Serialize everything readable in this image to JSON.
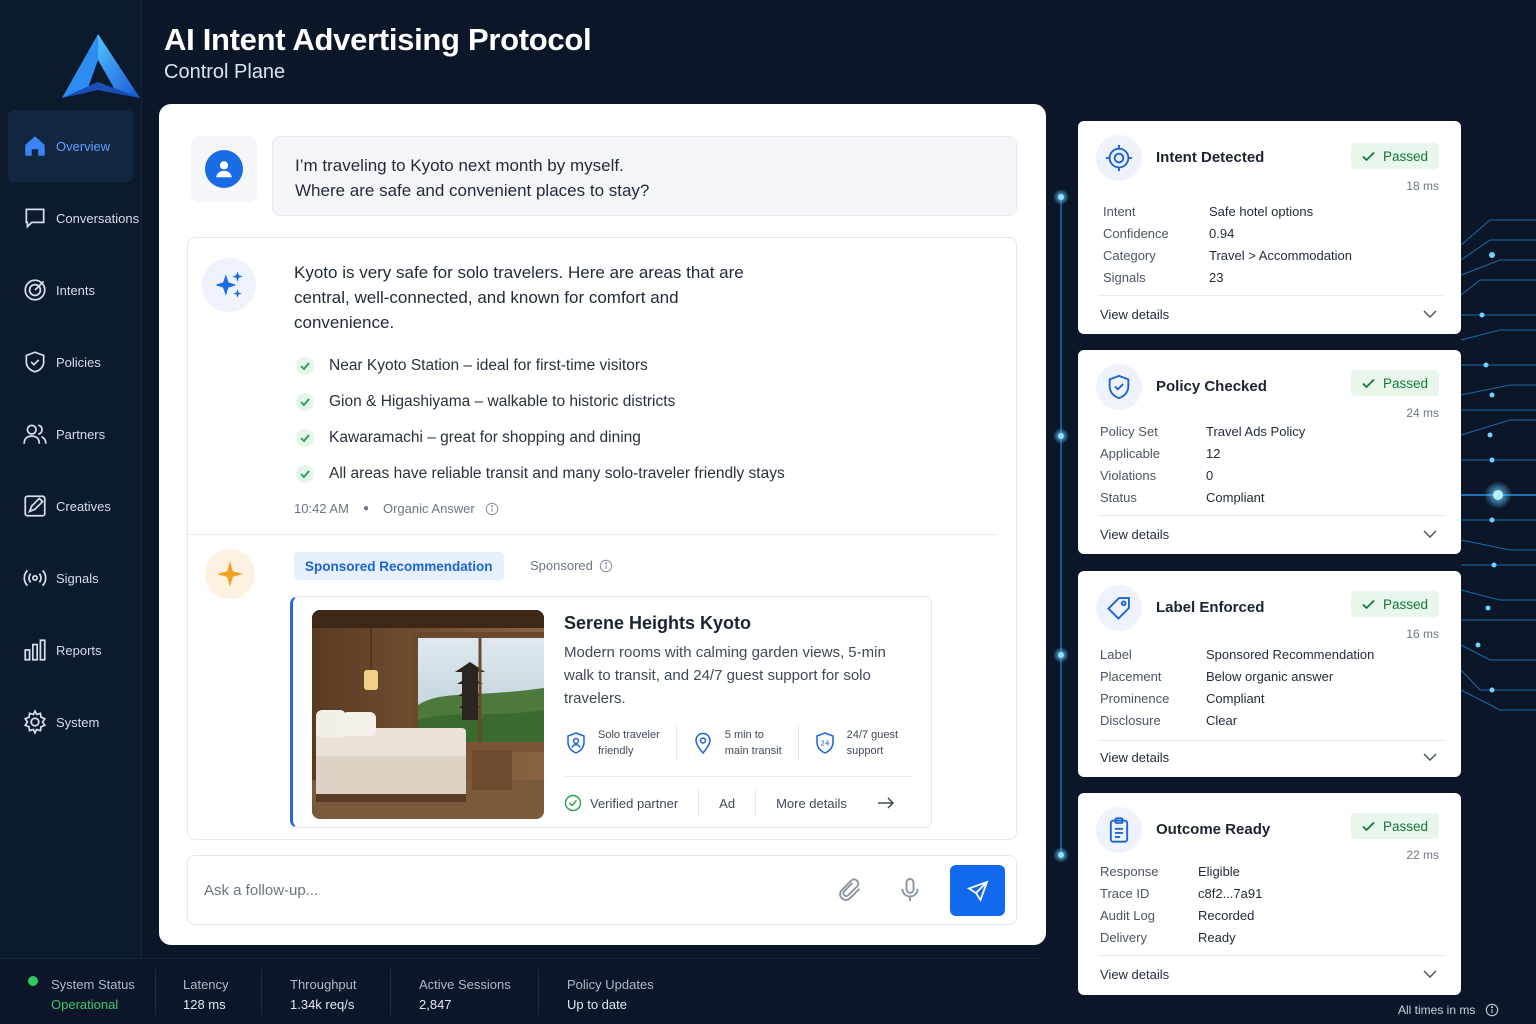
{
  "header": {
    "title": "AI Intent Advertising Protocol",
    "subtitle": "Control Plane"
  },
  "sidebar": {
    "items": [
      {
        "label": "Overview",
        "icon": "home-icon",
        "active": true
      },
      {
        "label": "Conversations",
        "icon": "chat-icon"
      },
      {
        "label": "Intents",
        "icon": "target-icon"
      },
      {
        "label": "Policies",
        "icon": "shield-icon"
      },
      {
        "label": "Partners",
        "icon": "users-icon"
      },
      {
        "label": "Creatives",
        "icon": "edit-icon"
      },
      {
        "label": "Signals",
        "icon": "signal-icon"
      },
      {
        "label": "Reports",
        "icon": "bar-chart-icon"
      },
      {
        "label": "System",
        "icon": "gear-icon"
      }
    ]
  },
  "chat": {
    "user_message_line1": "I’m traveling to Kyoto next month by myself.",
    "user_message_line2": "Where are safe and convenient places to stay?",
    "answer": "Kyoto is very safe for solo travelers. Here are areas that are central, well-connected, and known for comfort and convenience.",
    "bullets": [
      "Near Kyoto Station – ideal for first-time visitors",
      "Gion & Higashiyama – walkable to historic districts",
      "Kawaramachi – great for shopping and dining",
      "All areas have reliable transit and many solo-traveler friendly stays"
    ],
    "time": "10:42 AM",
    "answer_type": "Organic Answer",
    "sponsored_label": "Sponsored Recommendation",
    "sponsored_text": "Sponsored",
    "ad": {
      "title": "Serene Heights Kyoto",
      "description": "Modern rooms with calming garden views, 5-min walk to transit, and 24/7 guest support for solo travelers.",
      "features": [
        {
          "line1": "Solo traveler",
          "line2": "friendly",
          "icon": "person-shield-icon"
        },
        {
          "line1": "5 min to",
          "line2": "main transit",
          "icon": "location-pin-icon"
        },
        {
          "line1": "24/7 guest",
          "line2": "support",
          "icon": "24-hour-icon"
        }
      ],
      "verified": "Verified partner",
      "ad_label": "Ad",
      "more": "More details"
    },
    "input_placeholder": "Ask a follow-up..."
  },
  "cards": [
    {
      "title": "Intent Detected",
      "status": "Passed",
      "ms": "18 ms",
      "icon": "target-icon",
      "rows": [
        [
          "Intent",
          "Safe hotel options"
        ],
        [
          "Confidence",
          "0.94"
        ],
        [
          "Category",
          "Travel > Accommodation"
        ],
        [
          "Signals",
          "23"
        ]
      ],
      "details": "View details"
    },
    {
      "title": "Policy Checked",
      "status": "Passed",
      "ms": "24 ms",
      "icon": "shield-check-icon",
      "rows": [
        [
          "Policy Set",
          "Travel Ads Policy"
        ],
        [
          "Applicable",
          "12"
        ],
        [
          "Violations",
          "0"
        ],
        [
          "Status",
          "Compliant"
        ]
      ],
      "details": "View details"
    },
    {
      "title": "Label Enforced",
      "status": "Passed",
      "ms": "16 ms",
      "icon": "tag-icon",
      "rows": [
        [
          "Label",
          "Sponsored Recommendation"
        ],
        [
          "Placement",
          "Below organic answer"
        ],
        [
          "Prominence",
          "Compliant"
        ],
        [
          "Disclosure",
          "Clear"
        ]
      ],
      "details": "View details"
    },
    {
      "title": "Outcome Ready",
      "status": "Passed",
      "ms": "22 ms",
      "icon": "clipboard-icon",
      "rows": [
        [
          "Response",
          "Eligible"
        ],
        [
          "Trace ID",
          "c8f2...7a91"
        ],
        [
          "Audit Log",
          "Recorded"
        ],
        [
          "Delivery",
          "Ready"
        ]
      ],
      "details": "View details"
    }
  ],
  "status_bar": {
    "system_status_label": "System Status",
    "system_status_value": "Operational",
    "latency_label": "Latency",
    "latency_value": "128 ms",
    "throughput_label": "Throughput",
    "throughput_value": "1.34k req/s",
    "sessions_label": "Active Sessions",
    "sessions_value": "2,847",
    "policy_label": "Policy Updates",
    "policy_value": "Up to date",
    "footnote": "All times in ms"
  },
  "colors": {
    "accent": "#1169ee",
    "pass": "#157a36",
    "background": "#0b1628",
    "ad_star": "#f0a224"
  }
}
